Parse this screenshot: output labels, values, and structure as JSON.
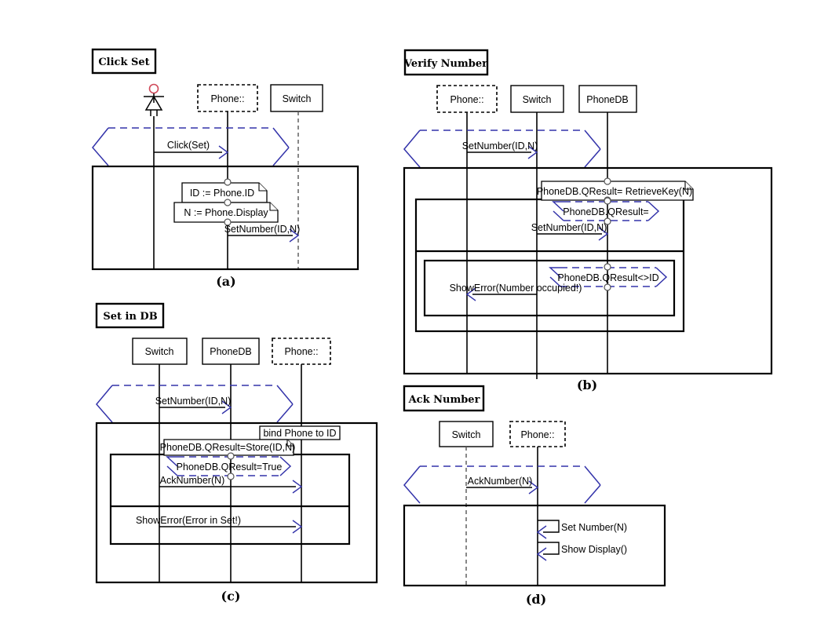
{
  "figure": {
    "caption_a": "(a)",
    "caption_b": "(b)",
    "caption_c": "(c)",
    "caption_d": "(d)"
  },
  "colors": {
    "blue_accent": "#3333aa",
    "actor_head": "#d04a5a",
    "line": "#000000",
    "background": "#ffffff"
  },
  "panels": [
    {
      "id": "a",
      "title": "Click Set",
      "caption": "(a)",
      "lifelines": [
        {
          "name": "actor",
          "label": "",
          "style": "actor"
        },
        {
          "name": "phone",
          "label": "Phone::",
          "style": "dashed"
        },
        {
          "name": "switch",
          "label": "Switch",
          "style": "solid"
        }
      ],
      "messages": [
        {
          "label": "Click(Set)",
          "from": "actor",
          "to": "phone"
        },
        {
          "label": "SetNumber(ID,N)",
          "from": "phone",
          "to": "switch"
        }
      ],
      "notes": [
        {
          "label": "ID := Phone.ID"
        },
        {
          "label": "N := Phone.Display"
        }
      ],
      "guards": []
    },
    {
      "id": "b",
      "title": "Verify Number",
      "caption": "(b)",
      "lifelines": [
        {
          "name": "phone",
          "label": "Phone::",
          "style": "dashed"
        },
        {
          "name": "switch",
          "label": "Switch",
          "style": "solid"
        },
        {
          "name": "phonedb",
          "label": "PhoneDB",
          "style": "solid"
        }
      ],
      "messages": [
        {
          "label": "SetNumber(ID,N)",
          "from": "phone",
          "to": "switch"
        },
        {
          "label": "SetNumber(ID,N)",
          "from": "switch",
          "to": "phonedb"
        },
        {
          "label": "ShowError(Number occupied!)",
          "from": "switch",
          "to": "phone"
        }
      ],
      "notes": [
        {
          "label": "PhoneDB.QResult= RetrieveKey(N)"
        }
      ],
      "guards": [
        {
          "label": "PhoneDB.QResult="
        },
        {
          "label": "PhoneDB.QResult<>ID"
        }
      ]
    },
    {
      "id": "c",
      "title": "Set in DB",
      "caption": "(c)",
      "lifelines": [
        {
          "name": "switch",
          "label": "Switch",
          "style": "solid"
        },
        {
          "name": "phonedb",
          "label": "PhoneDB",
          "style": "solid"
        },
        {
          "name": "phone",
          "label": "Phone::",
          "style": "dashed"
        }
      ],
      "messages": [
        {
          "label": "SetNumber(ID,N)",
          "from": "switch",
          "to": "phonedb"
        },
        {
          "label": "AckNumber(N)",
          "from": "switch",
          "to": "phone"
        },
        {
          "label": "ShowError(Error in Set!)",
          "from": "switch",
          "to": "phone"
        }
      ],
      "notes": [
        {
          "label": "PhoneDB.QResult=Store(ID,N)"
        },
        {
          "label": "bind Phone to ID",
          "style": "plain"
        }
      ],
      "guards": [
        {
          "label": "PhoneDB.QResult=True"
        }
      ]
    },
    {
      "id": "d",
      "title": "Ack Number",
      "caption": "(d)",
      "lifelines": [
        {
          "name": "switch",
          "label": "Switch",
          "style": "solid"
        },
        {
          "name": "phone",
          "label": "Phone::",
          "style": "dashed"
        }
      ],
      "messages": [
        {
          "label": "AckNumber(N)",
          "from": "switch",
          "to": "phone"
        },
        {
          "label": "Set Number(N)",
          "from": "phone",
          "to": "phone"
        },
        {
          "label": "Show Display()",
          "from": "phone",
          "to": "phone"
        }
      ],
      "notes": [],
      "guards": []
    }
  ]
}
